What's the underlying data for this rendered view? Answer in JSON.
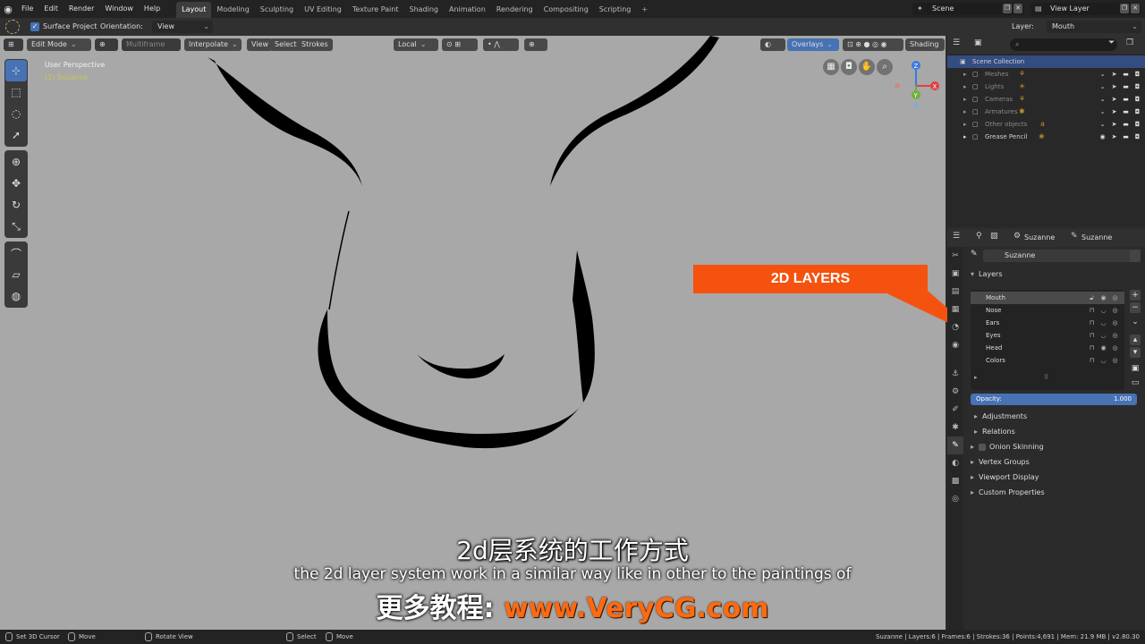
{
  "topbar": {
    "menus": [
      "File",
      "Edit",
      "Render",
      "Window",
      "Help"
    ],
    "workspaces": [
      "Layout",
      "Modeling",
      "Sculpting",
      "UV Editing",
      "Texture Paint",
      "Shading",
      "Animation",
      "Rendering",
      "Compositing",
      "Scripting"
    ],
    "active_workspace": "Layout",
    "add_workspace": "+",
    "scene": "Scene",
    "view_layer": "View Layer"
  },
  "toolsettings": {
    "surface_project": "Surface Project",
    "orientation_label": "Orientation:",
    "orientation_value": "View",
    "layer_label": "Layer:",
    "layer_value": "Mouth"
  },
  "viewport_header": {
    "mode": "Edit Mode",
    "multiframe": "Multiframe",
    "interpolate": "Interpolate",
    "view": "View",
    "select": "Select",
    "strokes": "Strokes",
    "transform": "Local",
    "overlays": "Overlays",
    "shading": "Shading"
  },
  "viewport": {
    "perspective": "User Perspective",
    "object": "(1) Suzanne",
    "background": "#a8a8a8",
    "stroke_color": "#000000"
  },
  "gizmo": {
    "z": "Z",
    "x": "X",
    "y": "Y"
  },
  "callout": {
    "text": "2D LAYERS",
    "color": "#f5520f"
  },
  "subtitles": {
    "chinese": "2d层系统的工作方式",
    "english": "the 2d layer system work in a similar way like in other to the paintings of",
    "promo_label": "更多教程: ",
    "promo_url": "www.VeryCG.com",
    "promo_color": "#ff6a10"
  },
  "outliner": {
    "search_placeholder": "",
    "items": [
      {
        "name": "Scene Collection",
        "selected": true
      },
      {
        "name": "Meshes"
      },
      {
        "name": "Lights"
      },
      {
        "name": "Cameras"
      },
      {
        "name": "Armatures"
      },
      {
        "name": "Other objects"
      },
      {
        "name": "Grease Pencil"
      }
    ]
  },
  "properties": {
    "breadcrumb_object": "Suzanne",
    "breadcrumb_data": "Suzanne",
    "data_name": "Suzanne",
    "layers_panel": "Layers",
    "layers": [
      {
        "name": "Mouth",
        "active": true
      },
      {
        "name": "Nose"
      },
      {
        "name": "Ears"
      },
      {
        "name": "Eyes"
      },
      {
        "name": "Head"
      },
      {
        "name": "Colors"
      }
    ],
    "opacity_label": "Opacity:",
    "opacity_value": "1.000",
    "panels": [
      "Adjustments",
      "Relations",
      "Onion Skinning",
      "Vertex Groups",
      "Viewport Display",
      "Custom Properties"
    ]
  },
  "statusbar": {
    "set_cursor": "Set 3D Cursor",
    "move1": "Move",
    "rotate_view": "Rotate View",
    "select": "Select",
    "move2": "Move",
    "stats": "Suzanne | Layers:6 | Frames:6 | Strokes:36 | Points:4,691 | Mem: 21.9 MB | v2.80.30"
  }
}
